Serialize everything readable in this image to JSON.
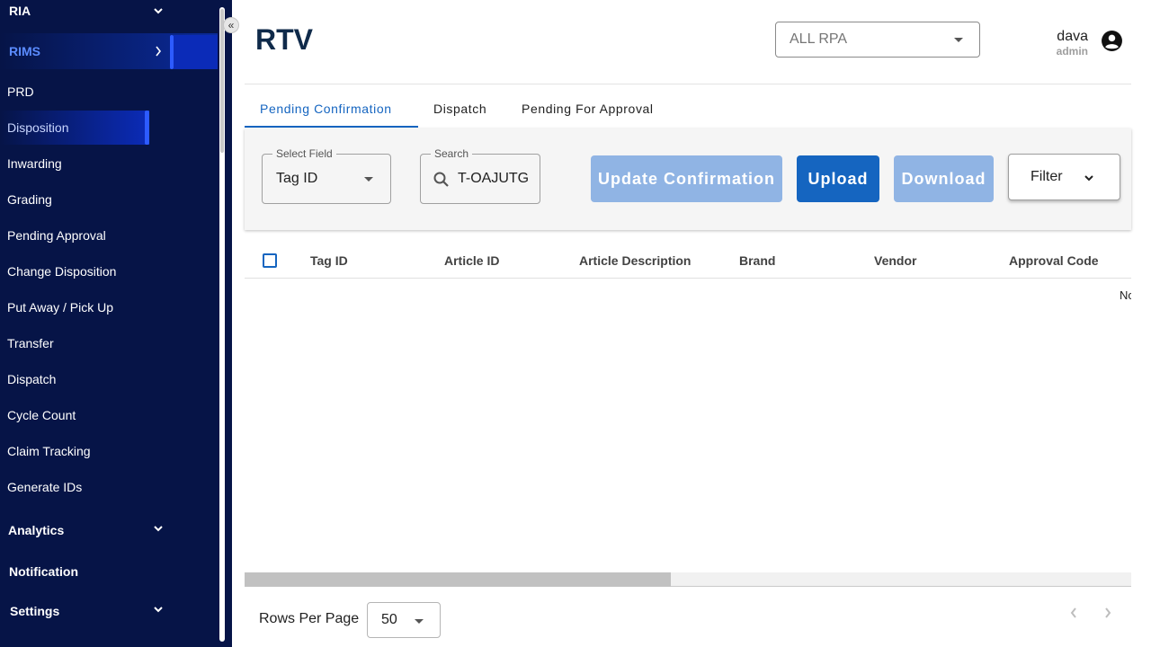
{
  "sidebar": {
    "groups": {
      "ria": "RIA",
      "rims": "RIMS",
      "analytics": "Analytics",
      "notification": "Notification",
      "settings": "Settings"
    },
    "items": [
      {
        "label": "PRD"
      },
      {
        "label": "Disposition",
        "active": true
      },
      {
        "label": "Inwarding"
      },
      {
        "label": "Grading"
      },
      {
        "label": "Pending Approval"
      },
      {
        "label": "Change Disposition"
      },
      {
        "label": "Put Away / Pick Up"
      },
      {
        "label": "Transfer"
      },
      {
        "label": "Dispatch"
      },
      {
        "label": "Cycle Count"
      },
      {
        "label": "Claim Tracking"
      },
      {
        "label": "Generate IDs"
      }
    ],
    "collapse_icon": "double-chevron-left-icon"
  },
  "header": {
    "title": "RTV",
    "rpa_select": {
      "value": "ALL RPA"
    },
    "user": {
      "name": "dava",
      "role": "admin",
      "icon": "account-circle-icon"
    }
  },
  "tabs": [
    {
      "label": "Pending Confirmation",
      "active": true
    },
    {
      "label": "Dispatch"
    },
    {
      "label": "Pending For Approval"
    }
  ],
  "toolbar": {
    "select_field": {
      "label": "Select Field",
      "value": "Tag ID"
    },
    "search": {
      "label": "Search",
      "value": "T-OAJUTG",
      "icon": "search-icon"
    },
    "update_confirmation_label": "Update Confirmation",
    "upload_label": "Upload",
    "download_label": "Download",
    "filter_label": "Filter"
  },
  "table": {
    "columns": [
      "Tag ID",
      "Article ID",
      "Article Description",
      "Brand",
      "Vendor",
      "Approval Code"
    ],
    "rows": [],
    "empty_text_visible": "No"
  },
  "footer": {
    "rows_per_page_label": "Rows Per Page",
    "rows_per_page_value": "50"
  },
  "colors": {
    "sidebar_bg": "#061447",
    "primary": "#1565c0",
    "disabled_button": "#90b4e4",
    "title": "#0f2a4a"
  }
}
